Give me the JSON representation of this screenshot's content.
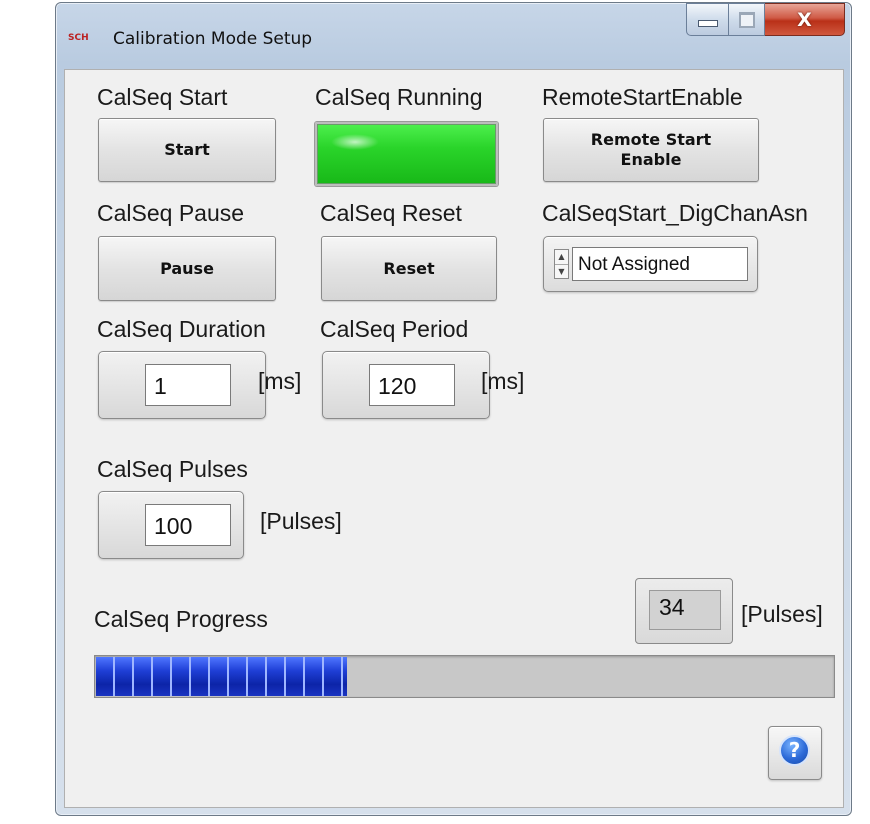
{
  "window": {
    "title": "Calibration Mode Setup",
    "app_icon_text": "SCH",
    "controls": {
      "minimize": "minimize",
      "maximize": "maximize",
      "close": "X"
    }
  },
  "controls": {
    "calseq_start": {
      "label": "CalSeq Start",
      "button": "Start"
    },
    "calseq_running": {
      "label": "CalSeq Running",
      "state": "on",
      "color": "#2ad42a"
    },
    "remote_start_enable": {
      "label": "RemoteStartEnable",
      "button_line1": "Remote Start",
      "button_line2": "Enable"
    },
    "calseq_pause": {
      "label": "CalSeq Pause",
      "button": "Pause"
    },
    "calseq_reset": {
      "label": "CalSeq Reset",
      "button": "Reset"
    },
    "digchan": {
      "label": "CalSeqStart_DigChanAsn",
      "value": "Not Assigned"
    },
    "duration": {
      "label": "CalSeq Duration",
      "value": "1",
      "unit": "[ms]"
    },
    "period": {
      "label": "CalSeq Period",
      "value": "120",
      "unit": "[ms]"
    },
    "pulses": {
      "label": "CalSeq Pulses",
      "value": "100",
      "unit": "[Pulses]"
    },
    "progress": {
      "label": "CalSeq Progress",
      "count": "34",
      "unit": "[Pulses]",
      "fraction": 0.34,
      "bar_color": "#1f3fd6"
    }
  },
  "help": {
    "icon": "question-mark-icon",
    "glyph": "?"
  }
}
